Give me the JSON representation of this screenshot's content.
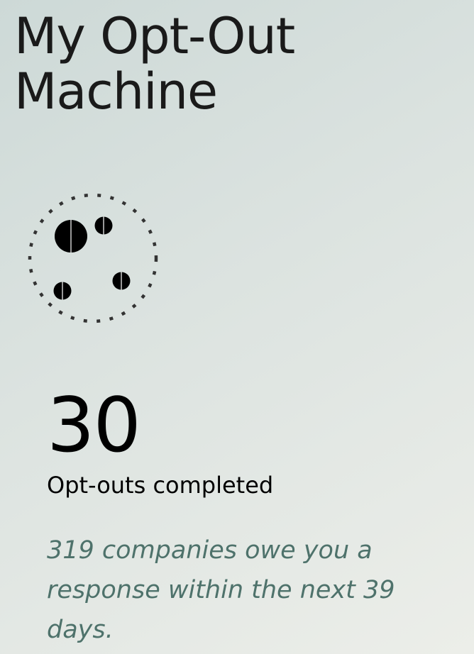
{
  "header": {
    "title_line1": "My Opt-Out",
    "title_line2": "Machine"
  },
  "machine": {
    "icon": "dotted-circle-with-dots",
    "ring_color": "#333333",
    "ball_color": "#000000"
  },
  "stats": {
    "count": "30",
    "label": "Opt-outs completed"
  },
  "message": {
    "text": "319 companies owe you a response within the next 39 days.",
    "color": "#4e726b"
  }
}
